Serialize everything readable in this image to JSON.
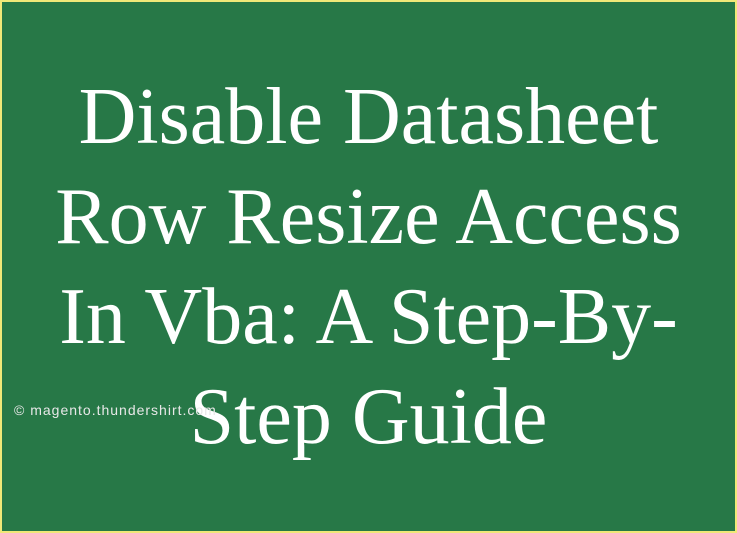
{
  "title": "Disable Datasheet Row Resize Access In Vba: A Step-By-Step Guide",
  "watermark": "© magento.thundershirt.com"
}
